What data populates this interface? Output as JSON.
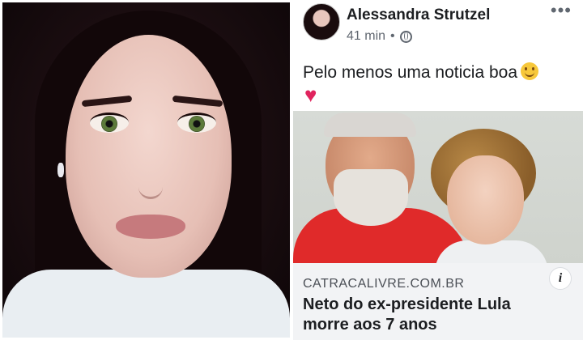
{
  "post": {
    "author": "Alessandra Strutzel",
    "time": "41 min",
    "separator": "•",
    "more": "•••",
    "text": "Pelo menos uma noticia boa",
    "heart": "♥",
    "link": {
      "domain": "CATRACALIVRE.COM.BR",
      "title": "Neto do ex-presidente Lula morre aos 7 anos",
      "info": "i"
    }
  },
  "colors": {
    "heart": "#e0245e",
    "link_footer": "#f2f3f5",
    "text": "#1c1e21",
    "meta": "#606770"
  }
}
